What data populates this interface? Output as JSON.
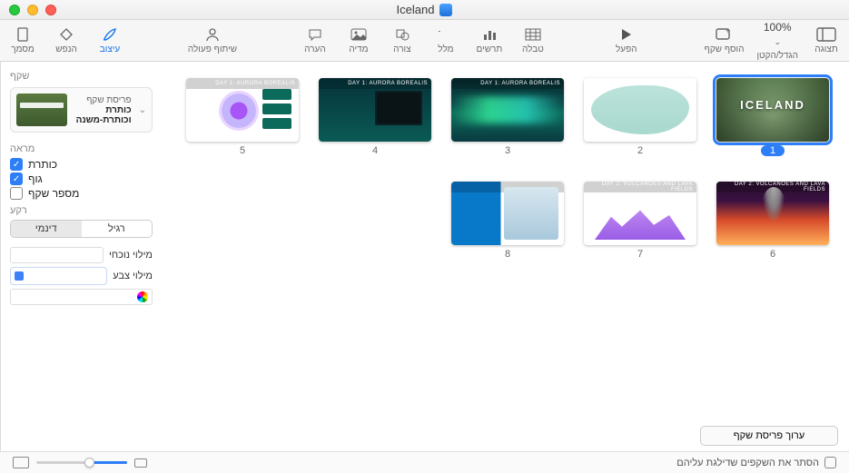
{
  "window": {
    "title": "Iceland"
  },
  "toolbar": {
    "right": [
      {
        "key": "view",
        "label": "תצוגה"
      },
      {
        "key": "zoom",
        "label": "הגדל/הקטן",
        "value": "100%"
      },
      {
        "key": "add_slide",
        "label": "הוסף שקף"
      }
    ],
    "center_right": [
      {
        "key": "play",
        "label": "הפעל"
      }
    ],
    "center": [
      {
        "key": "table",
        "label": "טבלה"
      },
      {
        "key": "chart",
        "label": "תרשים"
      },
      {
        "key": "text",
        "label": "מלל"
      },
      {
        "key": "shape",
        "label": "צורה"
      },
      {
        "key": "media",
        "label": "מדיה"
      },
      {
        "key": "comment",
        "label": "הערה"
      }
    ],
    "center_left": [
      {
        "key": "collab",
        "label": "שיתוף פעולה"
      }
    ],
    "left": [
      {
        "key": "format",
        "label": "עיצוב",
        "selected": true
      },
      {
        "key": "animate",
        "label": "הנפש"
      },
      {
        "key": "document",
        "label": "מסמך"
      }
    ]
  },
  "panel": {
    "tab": "שקף",
    "layout": {
      "caption": "פריסת שקף",
      "name": "כותרת וכותרת-משנה",
      "placeholder": "LOREM IPSUM"
    },
    "appearance": {
      "section": "מראה",
      "title_label": "כותרת",
      "title_on": true,
      "body_label": "גוף",
      "body_on": true,
      "slidenum_label": "מספר שקף",
      "slidenum_on": false
    },
    "background": {
      "section": "רקע",
      "seg_normal": "רגיל",
      "seg_dynamic": "דינמי",
      "seg_active": "דינמי",
      "current_fill_label": "מילוי נוכחי",
      "color_fill_label": "מילוי צבע"
    },
    "edit_layout": "ערוך פריסת שקף"
  },
  "slides": [
    {
      "n": 1,
      "title": "ICELAND",
      "selected": true,
      "variant": "th1"
    },
    {
      "n": 2,
      "variant": "th2"
    },
    {
      "n": 3,
      "header": "DAY 1: AURORA BOREALIS",
      "variant": "th3"
    },
    {
      "n": 4,
      "header": "DAY 1: AURORA BOREALIS",
      "variant": "th4"
    },
    {
      "n": 5,
      "header": "DAY 1: AURORA BOREALIS",
      "variant": "th5"
    },
    {
      "n": 6,
      "header": "DAY 2: VOLCANOES AND LAVA FIELDS",
      "variant": "th6"
    },
    {
      "n": 7,
      "header": "DAY 2: VOLCANOES AND LAVA FIELDS",
      "variant": "th7"
    },
    {
      "n": 8,
      "header": "",
      "variant": "th8"
    }
  ],
  "bottom": {
    "hide_skipped": "הסתר את השקפים שדילגת עליהם"
  }
}
